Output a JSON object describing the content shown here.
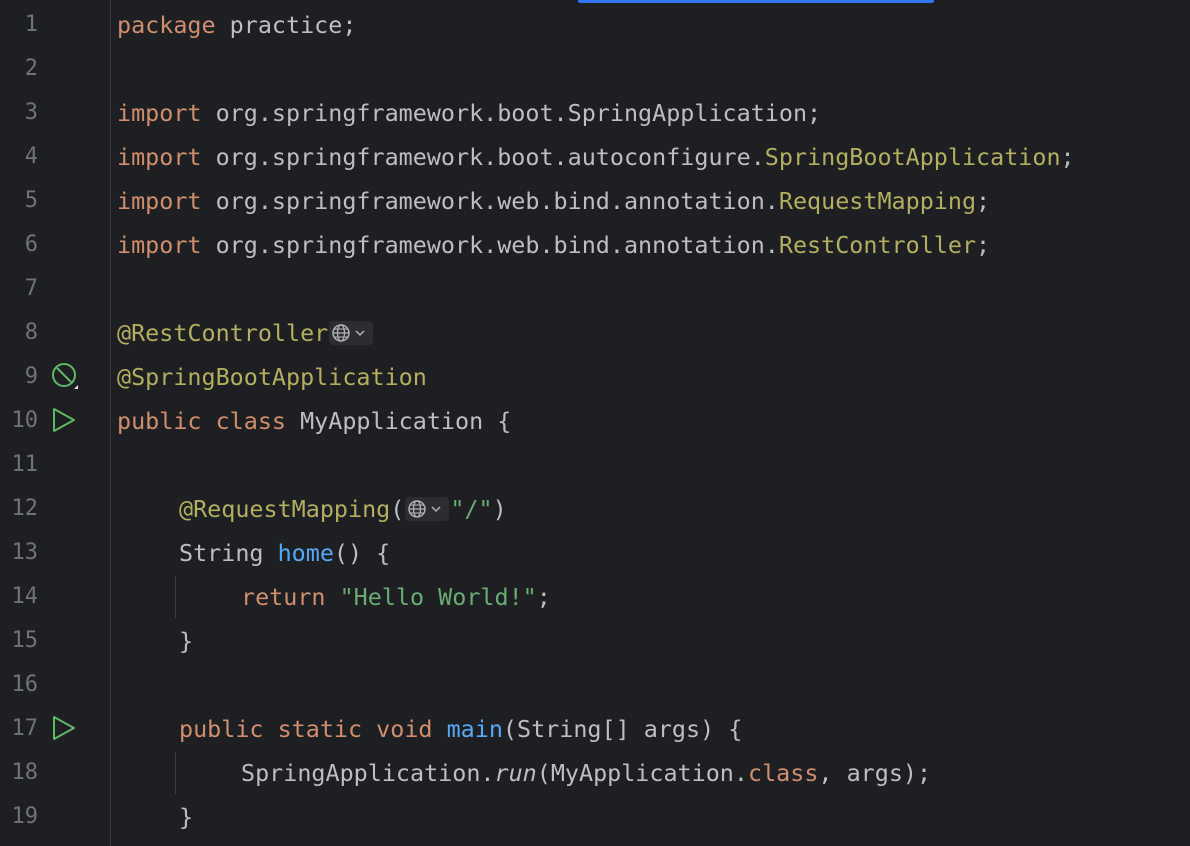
{
  "editor": {
    "colors": {
      "background": "#1e1f22",
      "keyword": "#cf8e6d",
      "annotation": "#b3ae60",
      "string": "#6aab73",
      "function": "#56a8f5",
      "text": "#bcbec4",
      "line_number": "#6f737a",
      "run_icon": "#5fb865"
    },
    "gutter_icons": {
      "line9": "spring-bean-icon",
      "line10": "run-icon",
      "line17": "run-icon",
      "inlay": "globe-endpoint-icon"
    },
    "lines": [
      {
        "n": "1",
        "t": {
          "kw": "package",
          "rest": " practice;"
        }
      },
      {
        "n": "2"
      },
      {
        "n": "3",
        "t": {
          "kw": "import",
          "pkg": " org.springframework.boot.SpringApplication;"
        }
      },
      {
        "n": "4",
        "t": {
          "kw": "import",
          "pkg": " org.springframework.boot.autoconfigure.",
          "cls": "SpringBootApplication",
          "end": ";"
        }
      },
      {
        "n": "5",
        "t": {
          "kw": "import",
          "pkg": " org.springframework.web.bind.annotation.",
          "cls": "RequestMapping",
          "end": ";"
        }
      },
      {
        "n": "6",
        "t": {
          "kw": "import",
          "pkg": " org.springframework.web.bind.annotation.",
          "cls": "RestController",
          "end": ";"
        }
      },
      {
        "n": "7"
      },
      {
        "n": "8",
        "t": {
          "ann": "@RestController"
        }
      },
      {
        "n": "9",
        "t": {
          "ann": "@SpringBootApplication"
        }
      },
      {
        "n": "10",
        "t": {
          "kw": "public class",
          "rest": " MyApplication {"
        }
      },
      {
        "n": "11"
      },
      {
        "n": "12",
        "t": {
          "ann": "@RequestMapping",
          "open": "(",
          "str": "\"/\"",
          "close": ")"
        }
      },
      {
        "n": "13",
        "t": {
          "type": "String ",
          "fn": "home",
          "rest": "() {"
        }
      },
      {
        "n": "14",
        "t": {
          "kw": "return",
          "sp": " ",
          "str": "\"Hello World!\"",
          "end": ";"
        }
      },
      {
        "n": "15",
        "t": {
          "rest": "}"
        }
      },
      {
        "n": "16"
      },
      {
        "n": "17",
        "t": {
          "kw": "public static void",
          "sp": " ",
          "fn": "main",
          "rest": "(String[] args) {"
        }
      },
      {
        "n": "18",
        "t": {
          "a": "SpringApplication.",
          "it": "run",
          "b": "(MyApplication.",
          "kw": "class",
          "c": ", args);"
        }
      },
      {
        "n": "19",
        "t": {
          "rest": "}"
        }
      }
    ]
  }
}
